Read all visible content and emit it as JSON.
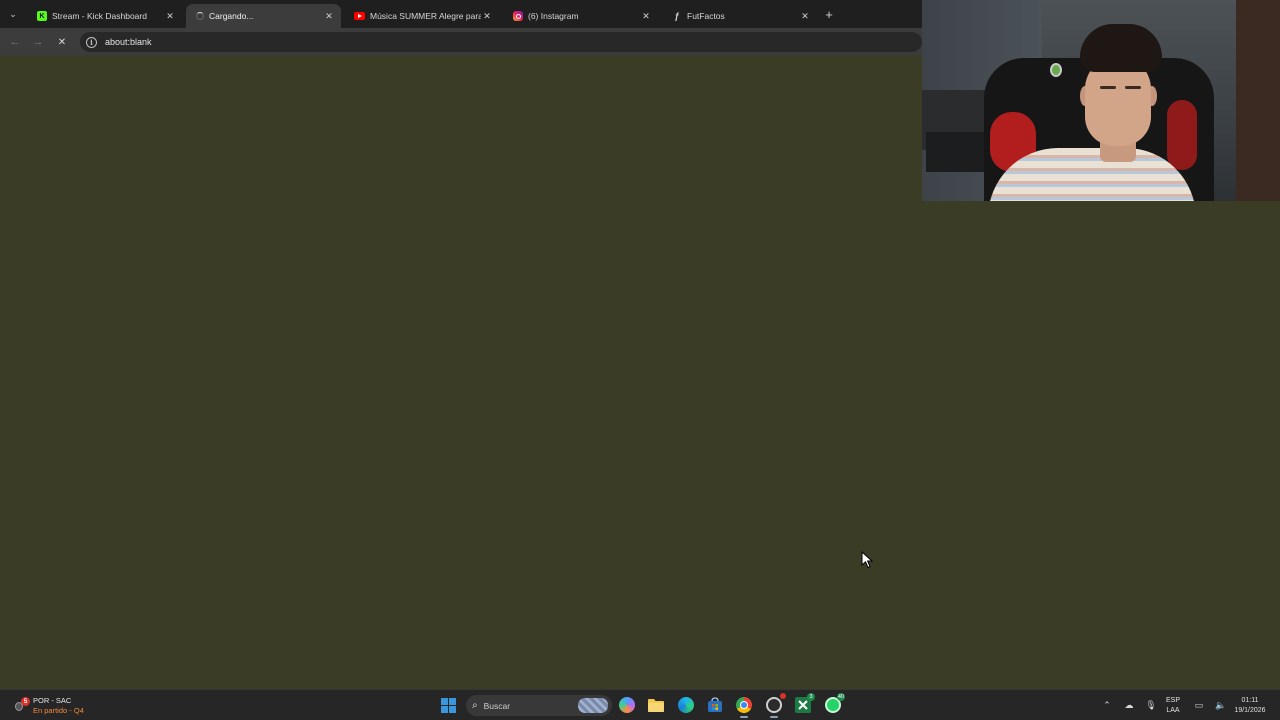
{
  "browser": {
    "tabs": [
      {
        "title": "Stream - Kick Dashboard",
        "favicon": "kick-icon",
        "active": false
      },
      {
        "title": "Cargando...",
        "favicon": "loading-spinner-icon",
        "active": true
      },
      {
        "title": "Música SUMMER Alegre para T",
        "favicon": "youtube-icon",
        "active": false
      },
      {
        "title": "(6) Instagram",
        "favicon": "instagram-icon",
        "active": false
      },
      {
        "title": "FutFactos",
        "favicon": "futfactos-icon",
        "active": false
      }
    ],
    "tab_close_glyph": "✕",
    "new_tab_glyph": "+",
    "tab_search_glyph": "⌄",
    "address": "about:blank",
    "back_glyph": "←",
    "forward_glyph": "→",
    "stop_glyph": "✕",
    "info_glyph": "i",
    "page_background": "#3a3c26"
  },
  "taskbar": {
    "widget": {
      "line1": "POR - SAC",
      "line2": "En partido - Q4",
      "badge": "5"
    },
    "search_placeholder": "Buscar",
    "apps": [
      {
        "name": "start-button",
        "icon": "windows-icon"
      },
      {
        "name": "copilot",
        "icon": "copilot-icon"
      },
      {
        "name": "file-explorer",
        "icon": "folder-icon"
      },
      {
        "name": "edge",
        "icon": "edge-icon"
      },
      {
        "name": "store",
        "icon": "store-icon"
      },
      {
        "name": "chrome",
        "icon": "chrome-icon"
      },
      {
        "name": "obs",
        "icon": "obs-icon"
      },
      {
        "name": "excel",
        "icon": "excel-icon",
        "badge": "3"
      },
      {
        "name": "whatsapp",
        "icon": "whatsapp-icon",
        "badge": "40"
      }
    ],
    "language": {
      "line1": "ESP",
      "line2": "LAA"
    },
    "clock": {
      "time": "01:11",
      "date": "19/1/2026"
    }
  }
}
